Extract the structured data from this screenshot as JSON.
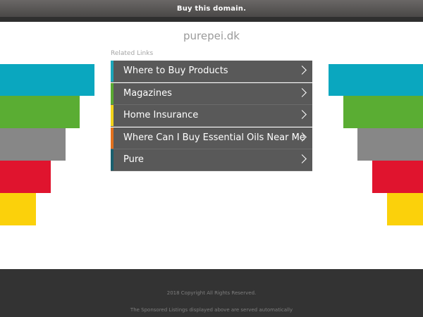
{
  "topbar": {
    "buy_label": "Buy this domain."
  },
  "header": {
    "domain": "purepei.dk"
  },
  "related": {
    "title": "Related Links",
    "items": [
      {
        "label": "Where to Buy Products",
        "accent": "#1ba5b8"
      },
      {
        "label": "Magazines",
        "accent": "#5aa932"
      },
      {
        "label": "Home Insurance",
        "accent": "#f2d31a"
      },
      {
        "label": "Where Can I Buy Essential Oils Near Me",
        "accent": "#e2711d"
      },
      {
        "label": "Pure",
        "accent": "#1a5f6e"
      }
    ]
  },
  "colors": {
    "cyan": "#0aa7bf",
    "green": "#5aad33",
    "gray": "#878787",
    "red": "#e0142e",
    "yellow": "#fbd10b"
  },
  "footer": {
    "copyright": "2018 Copyright All Rights Reserved.",
    "sponsored": "The Sponsored Listings displayed above are served automatically"
  }
}
